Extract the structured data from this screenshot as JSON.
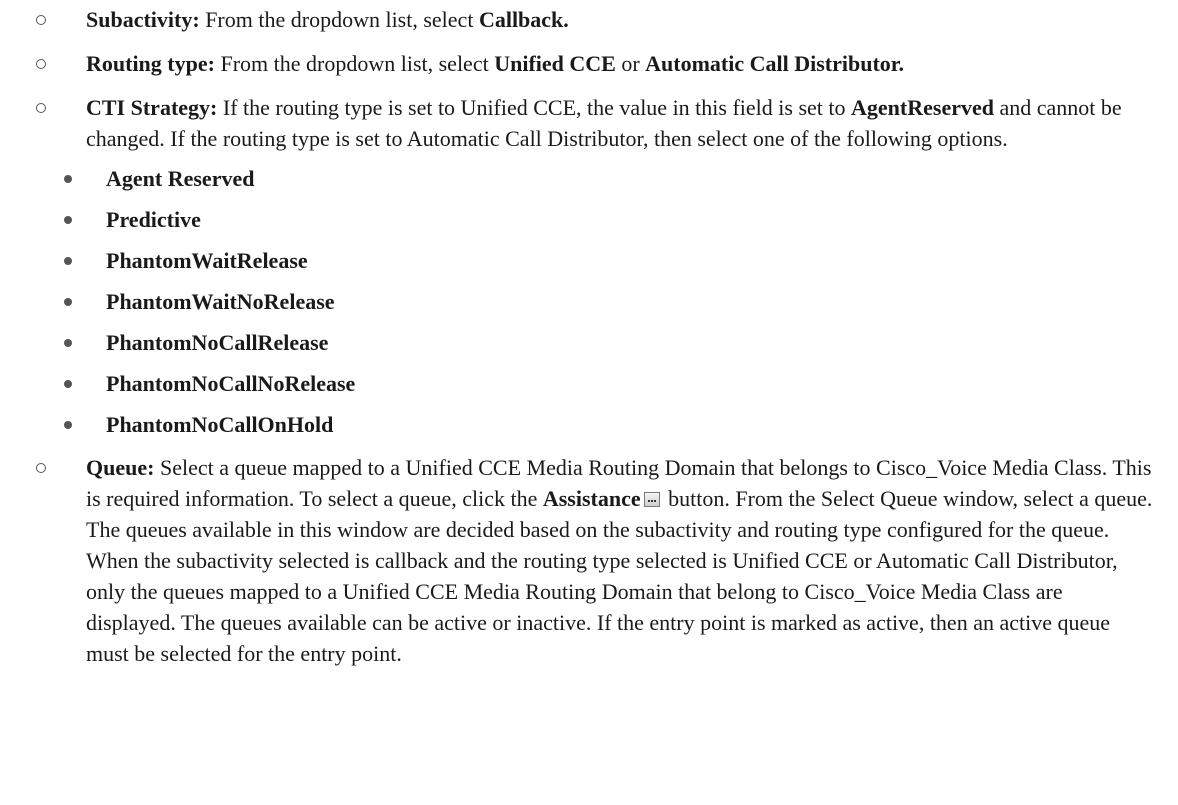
{
  "items": [
    {
      "label": "Subactivity:",
      "text1": " From the dropdown list, select ",
      "bold1": "Callback.",
      "text2": ""
    },
    {
      "label": "Routing type:",
      "text1": " From the dropdown list, select ",
      "bold1": "Unified CCE",
      "text2": " or ",
      "bold2": "Automatic Call Distributor."
    },
    {
      "label": "CTI Strategy:",
      "text1": " If the routing type is set to Unified CCE, the value in this field is set to ",
      "bold1": "AgentReserved",
      "text2": " and cannot be changed. If the routing type is set to Automatic Call Distributor, then select one of the following options."
    },
    {
      "label": "Queue:",
      "text1": " Select a queue mapped to a Unified CCE Media Routing Domain that belongs to Cisco_Voice Media Class. This is required information. To select a queue, click the ",
      "bold1": "Assistance",
      "text2": " button. From the Select Queue window, select a queue. The queues available in this window are decided based on the subactivity and routing type configured for the queue. When the subactivity selected is callback and the routing type selected is Unified CCE or Automatic Call Distributor, only the queues mapped to a Unified CCE Media Routing Domain that belong to Cisco_Voice Media Class are displayed. The queues available can be active or inactive. If the entry point is marked as active, then an active queue must be selected for the entry point."
    }
  ],
  "cti_options": [
    "Agent Reserved",
    "Predictive",
    "PhantomWaitRelease",
    "PhantomWaitNoRelease",
    "PhantomNoCallRelease",
    "PhantomNoCallNoRelease",
    "PhantomNoCallOnHold"
  ],
  "icons": {
    "assistance": "assistance-button-icon"
  }
}
